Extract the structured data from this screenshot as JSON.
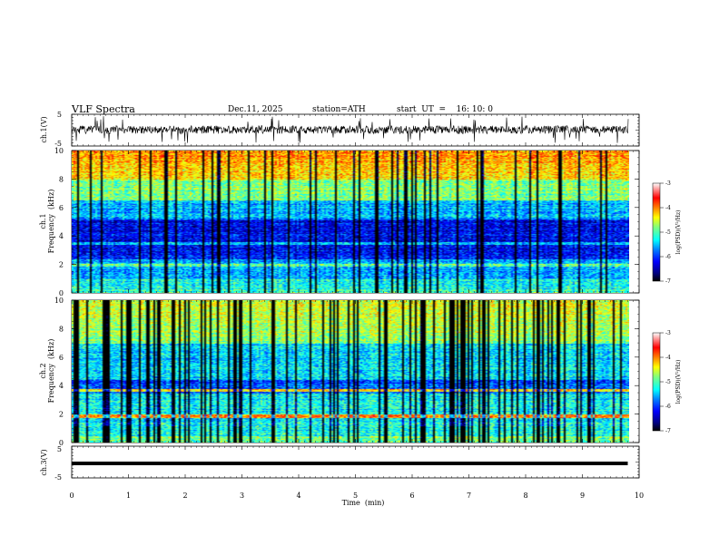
{
  "header": {
    "title": "VLF  Spectra",
    "date": "Dec.11, 2025",
    "station": "station=ATH",
    "start_ut": "start  UT  =    16: 10: 0"
  },
  "chart_data": {
    "type": "heatmap",
    "xlabel": "Time  (min)",
    "x_range": [
      0,
      10
    ],
    "x_ticks": [
      "0",
      "1",
      "2",
      "3",
      "4",
      "5",
      "6",
      "7",
      "8",
      "9",
      "10"
    ],
    "data_end_min": 9.8,
    "panels": [
      {
        "name": "ch1-waveform",
        "type": "line",
        "ylabel": "ch.1(V)",
        "y_ticks": [
          "5",
          "-5"
        ],
        "ylim": [
          -5,
          5
        ]
      },
      {
        "name": "ch1-spectrogram",
        "type": "heatmap",
        "ylabel_top": "ch.1",
        "ylabel": "Frequency  (kHz)",
        "y_ticks": [
          "0",
          "2",
          "4",
          "6",
          "8",
          "10"
        ],
        "ylim": [
          0,
          10
        ],
        "colorbar": {
          "label": "log(PSD)(V²/Hz)",
          "ticks": [
            "-3",
            "-4",
            "-5",
            "-6",
            "-7"
          ],
          "range": [
            -7,
            -3
          ]
        }
      },
      {
        "name": "ch2-spectrogram",
        "type": "heatmap",
        "ylabel_top": "ch.2",
        "ylabel": "Frequency  (kHz)",
        "y_ticks": [
          "0",
          "2",
          "4",
          "6",
          "8",
          "10"
        ],
        "ylim": [
          0,
          10
        ],
        "colorbar": {
          "label": "log(PSD)(V²/Hz)",
          "ticks": [
            "-3",
            "-4",
            "-5",
            "-6",
            "-7"
          ],
          "range": [
            -7,
            -3
          ]
        }
      },
      {
        "name": "ch3-waveform",
        "type": "line",
        "ylabel": "ch.3(V)",
        "y_ticks": [
          "5",
          "-5"
        ],
        "ylim": [
          -5,
          5
        ]
      }
    ]
  },
  "colors": {
    "colormap": [
      "#000000",
      "#00007f",
      "#0000ff",
      "#007fff",
      "#00ffff",
      "#7fff7f",
      "#ffff00",
      "#ff7f00",
      "#ff0000",
      "#ffffff"
    ]
  }
}
